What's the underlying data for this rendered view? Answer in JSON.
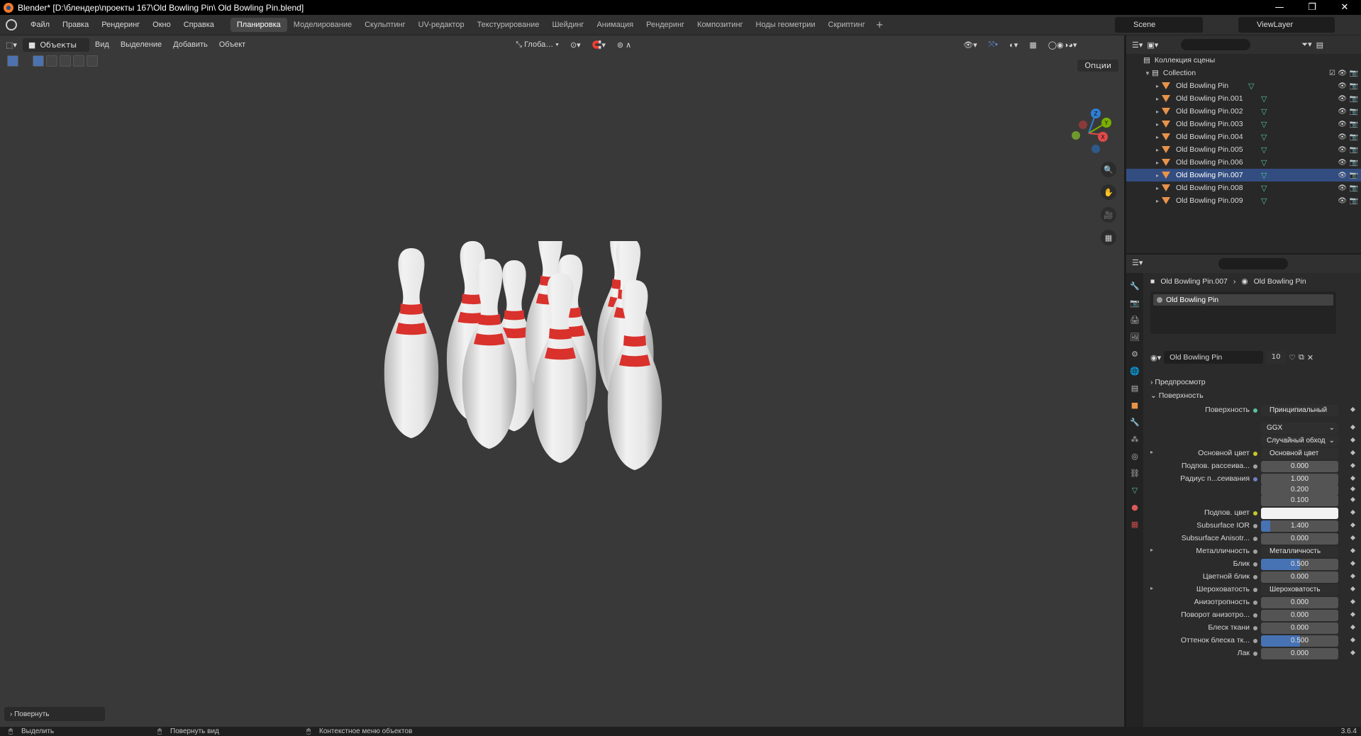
{
  "titlebar": {
    "title": "Blender* [D:\\блендер\\проекты 167\\Old Bowling Pin\\ Old Bowling Pin.blend]",
    "minimize": "—",
    "maximize": "❐",
    "close": "✕"
  },
  "menu": [
    "Файл",
    "Правка",
    "Рендеринг",
    "Окно",
    "Справка"
  ],
  "workspaces": [
    "Планировка",
    "Моделирование",
    "Скульптинг",
    "UV-редактор",
    "Текстурирование",
    "Шейдинг",
    "Анимация",
    "Рендеринг",
    "Композитинг",
    "Ноды геометрии",
    "Скриптинг"
  ],
  "active_workspace": "Планировка",
  "scene": {
    "scene_name": "Scene",
    "view_layer": "ViewLayer"
  },
  "viewport": {
    "mode": "Объекты",
    "menus": [
      "Вид",
      "Выделение",
      "Добавить",
      "Объект"
    ],
    "transform_orientation": "Глоба…",
    "options_label": "Опции",
    "operator_panel": "Повернуть",
    "gizmo_axes": [
      "X",
      "Y",
      "Z"
    ]
  },
  "outliner": {
    "root": "Коллекция сцены",
    "collection": "Collection",
    "objects": [
      "Old Bowling Pin",
      "Old Bowling Pin.001",
      "Old Bowling Pin.002",
      "Old Bowling Pin.003",
      "Old Bowling Pin.004",
      "Old Bowling Pin.005",
      "Old Bowling Pin.006",
      "Old Bowling Pin.007",
      "Old Bowling Pin.008",
      "Old Bowling Pin.009"
    ],
    "selected": "Old Bowling Pin.007"
  },
  "properties": {
    "breadcrumb_object": "Old Bowling Pin.007",
    "breadcrumb_material": "Old Bowling Pin",
    "slot_name": "Old Bowling Pin",
    "material_name": "Old Bowling Pin",
    "material_users": "10",
    "section_preview": "Предпросмотр",
    "section_surface": "Поверхность",
    "rows": [
      {
        "label": "Поверхность",
        "value": "Принципиальный BSDF",
        "kind": "link",
        "dot": "green"
      },
      {
        "label": "",
        "value": "GGX",
        "kind": "select"
      },
      {
        "label": "",
        "value": "Случайный обход",
        "kind": "select"
      },
      {
        "label": "Основной цвет",
        "value": "Основной цвет",
        "kind": "link",
        "dot": "yellow",
        "expand": true
      },
      {
        "label": "Подпов. рассеива...",
        "value": "0.000",
        "kind": "num",
        "dot": "gray"
      },
      {
        "label": "Радиус п...сеивания",
        "value": "1.000",
        "kind": "num",
        "dot": "blue"
      },
      {
        "label": "",
        "value": "0.200",
        "kind": "num"
      },
      {
        "label": "",
        "value": "0.100",
        "kind": "num"
      },
      {
        "label": "Подпов. цвет",
        "value": "",
        "kind": "color",
        "dot": "yellow"
      },
      {
        "label": "Subsurface IOR",
        "value": "1.400",
        "kind": "num",
        "dot": "gray",
        "fill": 0.12
      },
      {
        "label": "Subsurface Anisotr...",
        "value": "0.000",
        "kind": "num",
        "dot": "gray"
      },
      {
        "label": "Металличность",
        "value": "Металличность",
        "kind": "link",
        "dot": "gray",
        "expand": true
      },
      {
        "label": "Блик",
        "value": "0.500",
        "kind": "num",
        "dot": "gray",
        "fill": 0.5
      },
      {
        "label": "Цветной блик",
        "value": "0.000",
        "kind": "num",
        "dot": "gray"
      },
      {
        "label": "Шероховатость",
        "value": "Шероховатость",
        "kind": "link",
        "dot": "gray",
        "expand": true
      },
      {
        "label": "Анизотропность",
        "value": "0.000",
        "kind": "num",
        "dot": "gray"
      },
      {
        "label": "Поворот анизотро...",
        "value": "0.000",
        "kind": "num",
        "dot": "gray"
      },
      {
        "label": "Блеск ткани",
        "value": "0.000",
        "kind": "num",
        "dot": "gray"
      },
      {
        "label": "Оттенок блеска тк...",
        "value": "0.500",
        "kind": "num",
        "dot": "gray",
        "fill": 0.5
      },
      {
        "label": "Лак",
        "value": "0.000",
        "kind": "num",
        "dot": "gray"
      }
    ]
  },
  "statusbar": {
    "left": "Выделить",
    "middle": "Повернуть вид",
    "right": "Контекстное меню объектов",
    "version": "3.6.4"
  },
  "colors": {
    "accent": "#4772b3",
    "selection": "#334d80",
    "mesh_icon": "#e8934a"
  }
}
